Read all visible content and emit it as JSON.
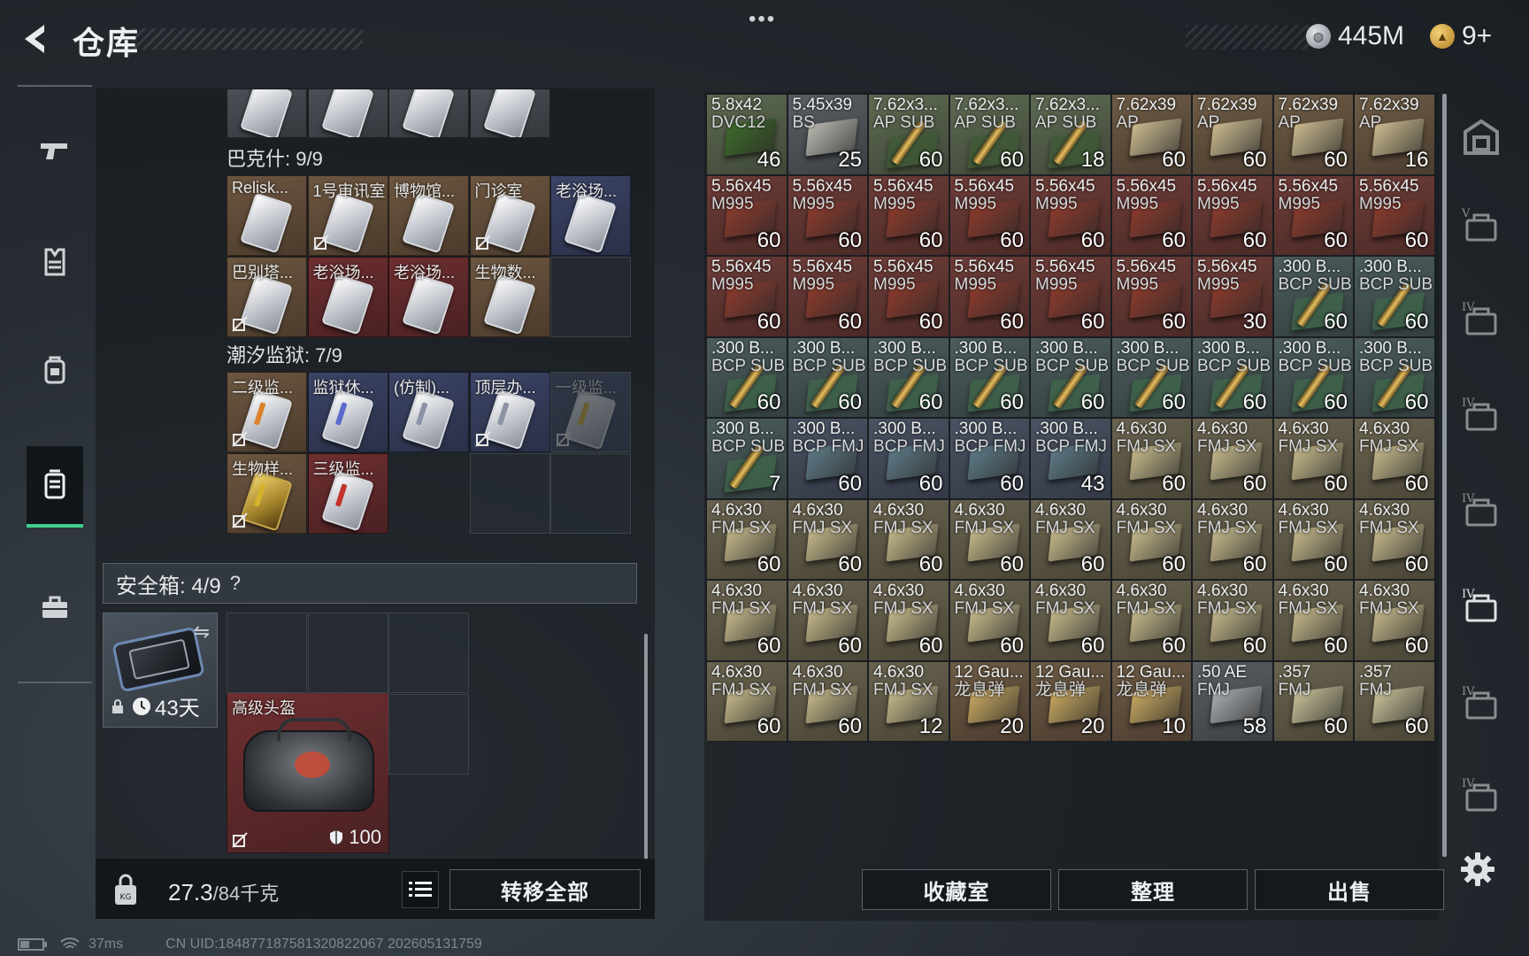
{
  "header": {
    "title": "仓库",
    "menu_dots": "•••",
    "currency_silver": "445M",
    "currency_gold": "9+",
    "colors": {
      "accent_green": "#3fcf8e",
      "panel_bg": "#262c32"
    }
  },
  "left_nav": {
    "items": [
      {
        "name": "weapon-tab",
        "icon": "pistol-icon"
      },
      {
        "name": "armor-tab",
        "icon": "vest-icon"
      },
      {
        "name": "backpack-tab",
        "icon": "backpack-icon"
      },
      {
        "name": "container-tab",
        "icon": "canister-icon",
        "active": true
      },
      {
        "name": "toolbox-tab",
        "icon": "briefcase-icon"
      }
    ]
  },
  "inventory": {
    "bakesh_label": "巴克什: 9/9",
    "tide_prison_label": "潮汐监狱: 7/9",
    "bakesh_cards": [
      {
        "name": "Relisk...",
        "bg": "brown",
        "locked": false
      },
      {
        "name": "1号审讯室",
        "bg": "brown",
        "locked": true
      },
      {
        "name": "博物馆...",
        "bg": "brown",
        "locked": false
      },
      {
        "name": "门诊室",
        "bg": "brown",
        "locked": true
      },
      {
        "name": "老浴场...",
        "bg": "blue",
        "locked": false
      },
      {
        "name": "巴别塔...",
        "bg": "brown",
        "locked": true
      },
      {
        "name": "老浴场...",
        "bg": "red",
        "locked": false
      },
      {
        "name": "老浴场...",
        "bg": "red",
        "locked": false
      },
      {
        "name": "生物数...",
        "bg": "brown",
        "locked": false
      }
    ],
    "prison_cards": [
      {
        "name": "二级监...",
        "bg": "brown",
        "locked": true,
        "stripe": "#d9822b"
      },
      {
        "name": "监狱休...",
        "bg": "blue",
        "locked": false,
        "stripe": "#5b6acc"
      },
      {
        "name": "(仿制)...",
        "bg": "blue",
        "locked": false,
        "stripe": "#8c93a6"
      },
      {
        "name": "顶层办...",
        "bg": "blue",
        "locked": true,
        "stripe": "#8c93a6"
      },
      {
        "name": "一级监...",
        "bg": "blue",
        "locked": true,
        "stripe": "#d6b22a"
      },
      {
        "name": "生物样...",
        "bg": "brown",
        "locked": true,
        "stripe": "#d6b22a",
        "gold": true
      },
      {
        "name": "三级监...",
        "bg": "red",
        "locked": false,
        "stripe": "#c2332b"
      }
    ],
    "safe_box": {
      "label": "安全箱: 4/9",
      "help": "?",
      "timer": "43天",
      "item_name": "高级头盔",
      "durability": "100"
    },
    "weight": {
      "current": "27.3",
      "max": "/84千克"
    },
    "transfer_all_label": "转移全部"
  },
  "stash": {
    "ammo": [
      {
        "cal": "5.8x42",
        "type": "DVC12",
        "count": "46",
        "tone": "green",
        "kind": "box",
        "box_color": "#3e6a2a"
      },
      {
        "cal": "5.45x39",
        "type": "BS",
        "count": "25",
        "tone": "gray",
        "kind": "box",
        "box_color": "#b8b8b0"
      },
      {
        "cal": "7.62x3...",
        "type": "AP SUB",
        "count": "60",
        "tone": "green",
        "kind": "round",
        "box_color": "#3d5a34"
      },
      {
        "cal": "7.62x3...",
        "type": "AP SUB",
        "count": "60",
        "tone": "green",
        "kind": "round",
        "box_color": "#3d5a34"
      },
      {
        "cal": "7.62x3...",
        "type": "AP SUB",
        "count": "18",
        "tone": "green",
        "kind": "round",
        "box_color": "#3d5a34"
      },
      {
        "cal": "7.62x39",
        "type": "AP",
        "count": "60",
        "tone": "brown",
        "kind": "box",
        "box_color": "#c9b98e"
      },
      {
        "cal": "7.62x39",
        "type": "AP",
        "count": "60",
        "tone": "brown",
        "kind": "box",
        "box_color": "#c9b98e"
      },
      {
        "cal": "7.62x39",
        "type": "AP",
        "count": "60",
        "tone": "brown",
        "kind": "box",
        "box_color": "#c9b98e"
      },
      {
        "cal": "7.62x39",
        "type": "AP",
        "count": "16",
        "tone": "brown",
        "kind": "box",
        "box_color": "#c9b98e"
      },
      {
        "cal": "5.56x45",
        "type": "M995",
        "count": "60",
        "tone": "red",
        "kind": "box",
        "box_color": "#8c3a2c"
      },
      {
        "cal": "5.56x45",
        "type": "M995",
        "count": "60",
        "tone": "red",
        "kind": "box",
        "box_color": "#8c3a2c"
      },
      {
        "cal": "5.56x45",
        "type": "M995",
        "count": "60",
        "tone": "red",
        "kind": "box",
        "box_color": "#8c3a2c"
      },
      {
        "cal": "5.56x45",
        "type": "M995",
        "count": "60",
        "tone": "red",
        "kind": "box",
        "box_color": "#8c3a2c"
      },
      {
        "cal": "5.56x45",
        "type": "M995",
        "count": "60",
        "tone": "red",
        "kind": "box",
        "box_color": "#8c3a2c"
      },
      {
        "cal": "5.56x45",
        "type": "M995",
        "count": "60",
        "tone": "red",
        "kind": "box",
        "box_color": "#8c3a2c"
      },
      {
        "cal": "5.56x45",
        "type": "M995",
        "count": "60",
        "tone": "red",
        "kind": "box",
        "box_color": "#8c3a2c"
      },
      {
        "cal": "5.56x45",
        "type": "M995",
        "count": "60",
        "tone": "red",
        "kind": "box",
        "box_color": "#8c3a2c"
      },
      {
        "cal": "5.56x45",
        "type": "M995",
        "count": "60",
        "tone": "red",
        "kind": "box",
        "box_color": "#8c3a2c"
      },
      {
        "cal": "5.56x45",
        "type": "M995",
        "count": "60",
        "tone": "red",
        "kind": "box",
        "box_color": "#8c3a2c"
      },
      {
        "cal": "5.56x45",
        "type": "M995",
        "count": "60",
        "tone": "red",
        "kind": "box",
        "box_color": "#8c3a2c"
      },
      {
        "cal": "5.56x45",
        "type": "M995",
        "count": "60",
        "tone": "red",
        "kind": "box",
        "box_color": "#8c3a2c"
      },
      {
        "cal": "5.56x45",
        "type": "M995",
        "count": "60",
        "tone": "red",
        "kind": "box",
        "box_color": "#8c3a2c"
      },
      {
        "cal": "5.56x45",
        "type": "M995",
        "count": "60",
        "tone": "red",
        "kind": "box",
        "box_color": "#8c3a2c"
      },
      {
        "cal": "5.56x45",
        "type": "M995",
        "count": "60",
        "tone": "red",
        "kind": "box",
        "box_color": "#8c3a2c"
      },
      {
        "cal": "5.56x45",
        "type": "M995",
        "count": "30",
        "tone": "red",
        "kind": "box",
        "box_color": "#8c3a2c"
      },
      {
        "cal": ".300 B...",
        "type": "BCP SUB",
        "count": "60",
        "tone": "teal",
        "kind": "round",
        "box_color": "#3f6a4a"
      },
      {
        "cal": ".300 B...",
        "type": "BCP SUB",
        "count": "60",
        "tone": "teal",
        "kind": "round",
        "box_color": "#3f6a4a"
      },
      {
        "cal": ".300 B...",
        "type": "BCP SUB",
        "count": "60",
        "tone": "teal",
        "kind": "round",
        "box_color": "#3f6a4a"
      },
      {
        "cal": ".300 B...",
        "type": "BCP SUB",
        "count": "60",
        "tone": "teal",
        "kind": "round",
        "box_color": "#3f6a4a"
      },
      {
        "cal": ".300 B...",
        "type": "BCP SUB",
        "count": "60",
        "tone": "teal",
        "kind": "round",
        "box_color": "#3f6a4a"
      },
      {
        "cal": ".300 B...",
        "type": "BCP SUB",
        "count": "60",
        "tone": "teal",
        "kind": "round",
        "box_color": "#3f6a4a"
      },
      {
        "cal": ".300 B...",
        "type": "BCP SUB",
        "count": "60",
        "tone": "teal",
        "kind": "round",
        "box_color": "#3f6a4a"
      },
      {
        "cal": ".300 B...",
        "type": "BCP SUB",
        "count": "60",
        "tone": "teal",
        "kind": "round",
        "box_color": "#3f6a4a"
      },
      {
        "cal": ".300 B...",
        "type": "BCP SUB",
        "count": "60",
        "tone": "teal",
        "kind": "round",
        "box_color": "#3f6a4a"
      },
      {
        "cal": ".300 B...",
        "type": "BCP SUB",
        "count": "60",
        "tone": "teal",
        "kind": "round",
        "box_color": "#3f6a4a"
      },
      {
        "cal": ".300 B...",
        "type": "BCP SUB",
        "count": "60",
        "tone": "teal",
        "kind": "round",
        "box_color": "#3f6a4a"
      },
      {
        "cal": ".300 B...",
        "type": "BCP SUB",
        "count": "7",
        "tone": "teal",
        "kind": "round",
        "box_color": "#3f6a4a"
      },
      {
        "cal": ".300 B...",
        "type": "BCP FMJ",
        "count": "60",
        "tone": "blue",
        "kind": "box",
        "box_color": "#5e7a86"
      },
      {
        "cal": ".300 B...",
        "type": "BCP FMJ",
        "count": "60",
        "tone": "blue",
        "kind": "box",
        "box_color": "#5e7a86"
      },
      {
        "cal": ".300 B...",
        "type": "BCP FMJ",
        "count": "60",
        "tone": "blue",
        "kind": "box",
        "box_color": "#5e7a86"
      },
      {
        "cal": ".300 B...",
        "type": "BCP FMJ",
        "count": "43",
        "tone": "blue",
        "kind": "box",
        "box_color": "#5e7a86"
      },
      {
        "cal": "4.6x30",
        "type": "FMJ SX",
        "count": "60",
        "tone": "tan",
        "kind": "box",
        "box_color": "#c4b88a"
      },
      {
        "cal": "4.6x30",
        "type": "FMJ SX",
        "count": "60",
        "tone": "tan",
        "kind": "box",
        "box_color": "#c4b88a"
      },
      {
        "cal": "4.6x30",
        "type": "FMJ SX",
        "count": "60",
        "tone": "tan",
        "kind": "box",
        "box_color": "#c4b88a"
      },
      {
        "cal": "4.6x30",
        "type": "FMJ SX",
        "count": "60",
        "tone": "tan",
        "kind": "box",
        "box_color": "#c4b88a"
      },
      {
        "cal": "4.6x30",
        "type": "FMJ SX",
        "count": "60",
        "tone": "tan",
        "kind": "box",
        "box_color": "#c4b88a"
      },
      {
        "cal": "4.6x30",
        "type": "FMJ SX",
        "count": "60",
        "tone": "tan",
        "kind": "box",
        "box_color": "#c4b88a"
      },
      {
        "cal": "4.6x30",
        "type": "FMJ SX",
        "count": "60",
        "tone": "tan",
        "kind": "box",
        "box_color": "#c4b88a"
      },
      {
        "cal": "4.6x30",
        "type": "FMJ SX",
        "count": "60",
        "tone": "tan",
        "kind": "box",
        "box_color": "#c4b88a"
      },
      {
        "cal": "4.6x30",
        "type": "FMJ SX",
        "count": "60",
        "tone": "tan",
        "kind": "box",
        "box_color": "#c4b88a"
      },
      {
        "cal": "4.6x30",
        "type": "FMJ SX",
        "count": "60",
        "tone": "tan",
        "kind": "box",
        "box_color": "#c4b88a"
      },
      {
        "cal": "4.6x30",
        "type": "FMJ SX",
        "count": "60",
        "tone": "tan",
        "kind": "box",
        "box_color": "#c4b88a"
      },
      {
        "cal": "4.6x30",
        "type": "FMJ SX",
        "count": "60",
        "tone": "tan",
        "kind": "box",
        "box_color": "#c4b88a"
      },
      {
        "cal": "4.6x30",
        "type": "FMJ SX",
        "count": "60",
        "tone": "tan",
        "kind": "box",
        "box_color": "#c4b88a"
      },
      {
        "cal": "4.6x30",
        "type": "FMJ SX",
        "count": "60",
        "tone": "tan",
        "kind": "box",
        "box_color": "#c4b88a"
      },
      {
        "cal": "4.6x30",
        "type": "FMJ SX",
        "count": "60",
        "tone": "tan",
        "kind": "box",
        "box_color": "#c4b88a"
      },
      {
        "cal": "4.6x30",
        "type": "FMJ SX",
        "count": "60",
        "tone": "tan",
        "kind": "box",
        "box_color": "#c4b88a"
      },
      {
        "cal": "4.6x30",
        "type": "FMJ SX",
        "count": "60",
        "tone": "tan",
        "kind": "box",
        "box_color": "#c4b88a"
      },
      {
        "cal": "4.6x30",
        "type": "FMJ SX",
        "count": "60",
        "tone": "tan",
        "kind": "box",
        "box_color": "#c4b88a"
      },
      {
        "cal": "4.6x30",
        "type": "FMJ SX",
        "count": "60",
        "tone": "tan",
        "kind": "box",
        "box_color": "#c4b88a"
      },
      {
        "cal": "4.6x30",
        "type": "FMJ SX",
        "count": "60",
        "tone": "tan",
        "kind": "box",
        "box_color": "#c4b88a"
      },
      {
        "cal": "4.6x30",
        "type": "FMJ SX",
        "count": "60",
        "tone": "tan",
        "kind": "box",
        "box_color": "#c4b88a"
      },
      {
        "cal": "4.6x30",
        "type": "FMJ SX",
        "count": "60",
        "tone": "tan",
        "kind": "box",
        "box_color": "#c4b88a"
      },
      {
        "cal": "4.6x30",
        "type": "FMJ SX",
        "count": "60",
        "tone": "tan",
        "kind": "box",
        "box_color": "#c4b88a"
      },
      {
        "cal": "4.6x30",
        "type": "FMJ SX",
        "count": "60",
        "tone": "tan",
        "kind": "box",
        "box_color": "#c4b88a"
      },
      {
        "cal": "4.6x30",
        "type": "FMJ SX",
        "count": "12",
        "tone": "tan",
        "kind": "box",
        "box_color": "#c4b88a"
      },
      {
        "cal": "12 Gau...",
        "type": "龙息弹",
        "count": "20",
        "tone": "brown",
        "kind": "box",
        "box_color": "#c8a860"
      },
      {
        "cal": "12 Gau...",
        "type": "龙息弹",
        "count": "20",
        "tone": "brown",
        "kind": "box",
        "box_color": "#c8a860"
      },
      {
        "cal": "12 Gau...",
        "type": "龙息弹",
        "count": "10",
        "tone": "brown",
        "kind": "box",
        "box_color": "#c8a860"
      },
      {
        "cal": ".50 AE",
        "type": "FMJ",
        "count": "58",
        "tone": "gray",
        "kind": "box",
        "box_color": "#a8acb0"
      },
      {
        "cal": ".357",
        "type": "FMJ",
        "count": "60",
        "tone": "tan",
        "kind": "box",
        "box_color": "#c8c098"
      },
      {
        "cal": ".357",
        "type": "FMJ",
        "count": "60",
        "tone": "tan",
        "kind": "box",
        "box_color": "#c8c098"
      }
    ],
    "buttons": {
      "collection": "收藏室",
      "organize": "整理",
      "sell": "出售"
    },
    "right_tabs": [
      {
        "name": "all-tab",
        "icon": "vault-icon",
        "label": ""
      },
      {
        "name": "tab-v",
        "icon": "case-v-icon",
        "label": "V"
      },
      {
        "name": "tab-iv-1",
        "icon": "case-iv-icon",
        "label": "IV"
      },
      {
        "name": "tab-iv-2",
        "icon": "case-iv-icon",
        "label": "IV"
      },
      {
        "name": "tab-iv-3",
        "icon": "case-iv-icon",
        "label": "IV"
      },
      {
        "name": "tab-iv-4",
        "icon": "case-iv-icon",
        "label": "IV",
        "active": true
      },
      {
        "name": "tab-iv-5",
        "icon": "case-iv-icon",
        "label": "IV"
      },
      {
        "name": "tab-iv-6",
        "icon": "case-iv-icon",
        "label": "IV"
      }
    ]
  },
  "status": {
    "ping": "37ms",
    "uid": "CN UID:18487718758132082206​7 202605131759"
  }
}
